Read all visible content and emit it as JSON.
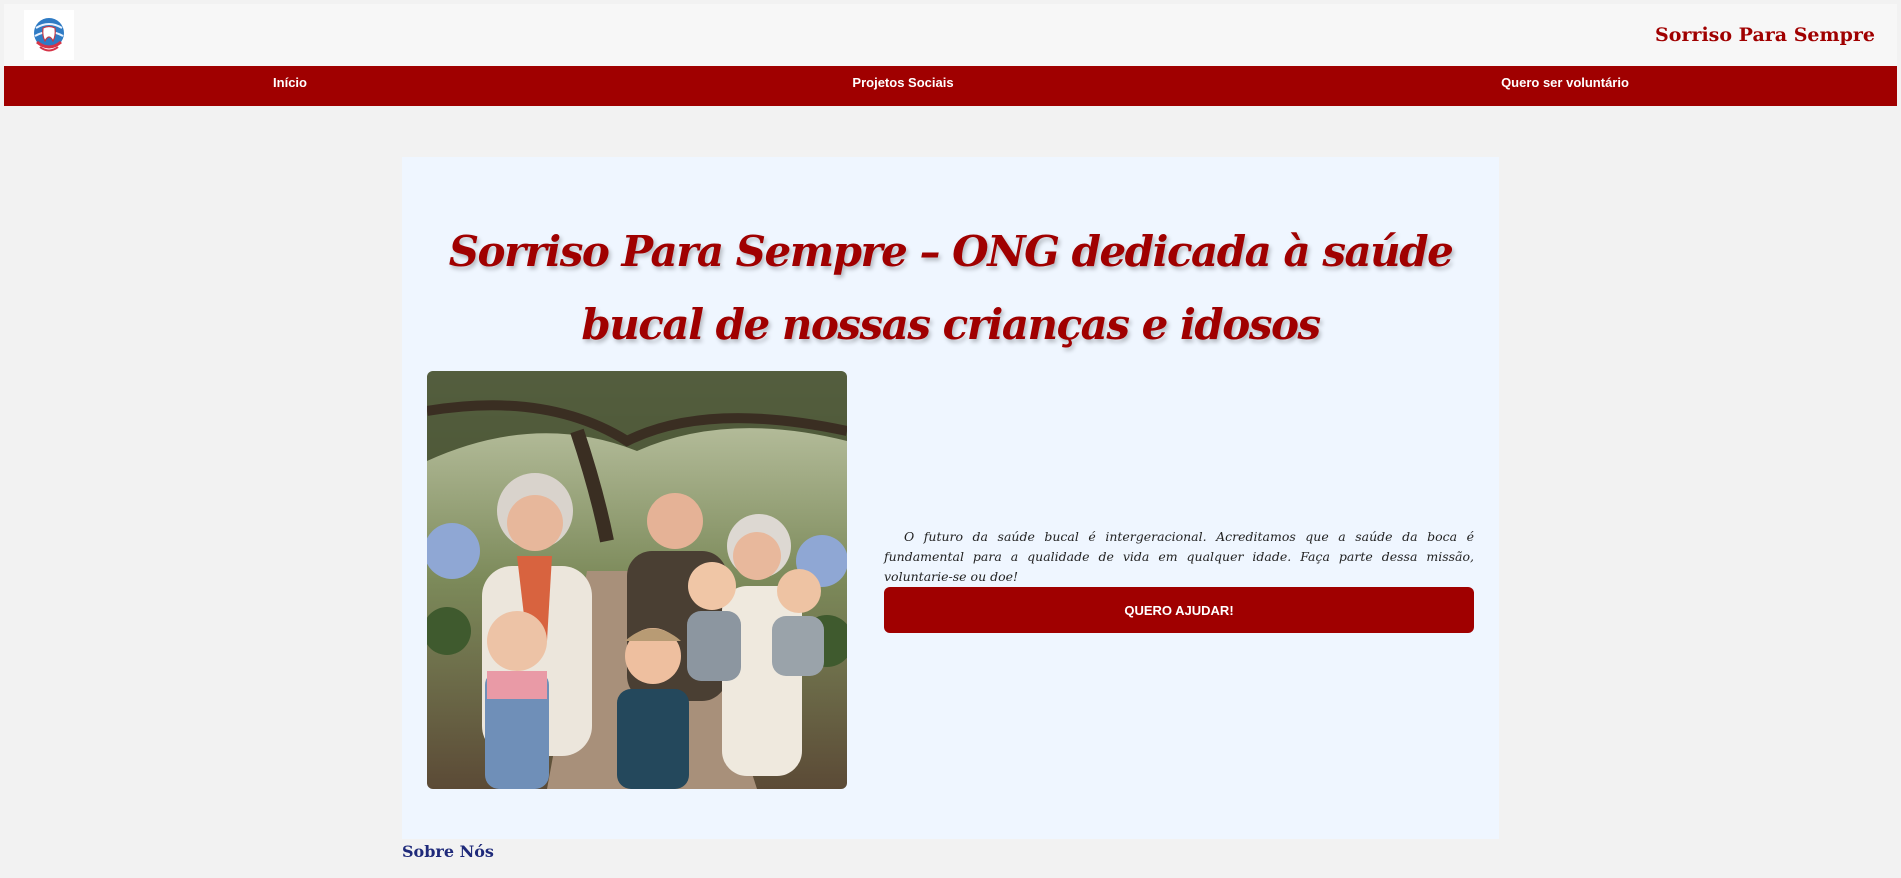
{
  "header": {
    "logo_icon": "tooth-globe-logo",
    "brand": "Sorriso Para Sempre"
  },
  "nav": {
    "items": [
      {
        "label": "Início"
      },
      {
        "label": "Projetos Sociais"
      },
      {
        "label": "Quero ser voluntário"
      }
    ]
  },
  "hero": {
    "title": "Sorriso Para Sempre – ONG dedicada à saúde bucal de nossas crianças e idosos",
    "intro": "O futuro da saúde bucal é intergeracional. Acreditamos que a saúde da boca é fundamental para a qualidade de vida em qualquer idade. Faça parte dessa missão, voluntarie-se ou doe!",
    "cta_label": "QUERO AJUDAR!"
  },
  "about": {
    "heading": "Sobre Nós"
  },
  "colors": {
    "brand_red": "#a00000",
    "hero_bg": "#eff6ff",
    "page_bg": "#f2f2f2",
    "about_heading": "#1f2a7a"
  }
}
